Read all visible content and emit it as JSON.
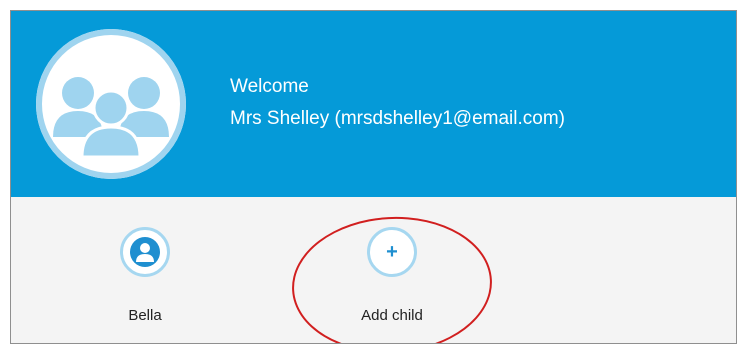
{
  "header": {
    "welcome": "Welcome",
    "user_line": "Mrs Shelley (mrsdshelley1@email.com)",
    "avatar_icon": "group-users-icon",
    "background_color": "#059ad8"
  },
  "children": [
    {
      "label": "Bella",
      "icon": "user-icon"
    },
    {
      "label": "Add child",
      "icon": "plus-icon"
    }
  ],
  "annotation": {
    "shape": "ellipse",
    "color": "#d11f1f",
    "target": "Add child"
  }
}
